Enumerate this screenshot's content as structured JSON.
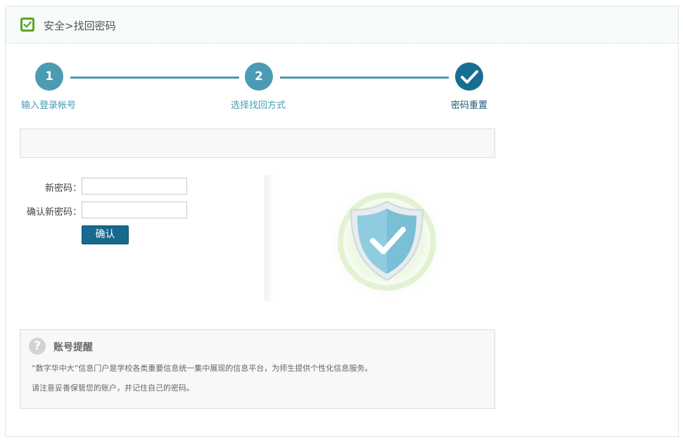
{
  "header": {
    "title": "安全>找回密码",
    "icon": "shield-check-icon"
  },
  "steps": [
    {
      "number": "1",
      "label": "输入登录帐号",
      "state": "done"
    },
    {
      "number": "2",
      "label": "选择找回方式",
      "state": "done"
    },
    {
      "number": "",
      "label": "密码重置",
      "state": "current"
    }
  ],
  "form": {
    "new_password_label": "新密码：",
    "new_password_value": "",
    "confirm_password_label": "确认新密码：",
    "confirm_password_value": "",
    "confirm_button": "确认"
  },
  "tip": {
    "title": "账号提醒",
    "lines": [
      "“数字华中大”信息门户是学校各类重要信息统一集中展现的信息平台，为师生提供个性化信息服务。",
      "请注意妥善保管您的账户，并记住自己的密码。"
    ]
  },
  "colors": {
    "accent": "#4a9bb3",
    "accent_dark": "#17698e",
    "shield": "#6bb3cc"
  }
}
